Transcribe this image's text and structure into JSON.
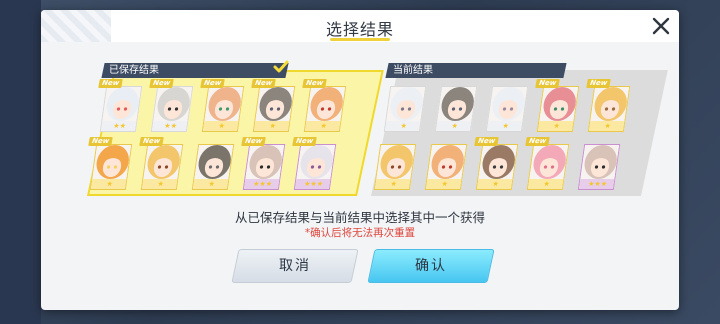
{
  "dialog": {
    "title": "选择结果",
    "close_icon": "close-icon"
  },
  "saved": {
    "label": "已保存结果",
    "selected_icon": "checkmark-icon",
    "cards": [
      {
        "new": "New",
        "stars": "★★",
        "rarity": "gray",
        "hair": "#e9eef5",
        "accent": "#e25a5a"
      },
      {
        "new": "New",
        "stars": "★★",
        "rarity": "gray",
        "hair": "#d8d6d3",
        "accent": "#333333"
      },
      {
        "new": "New",
        "stars": "★",
        "rarity": "gold",
        "hair": "#f0b48c",
        "accent": "#3c9a6a"
      },
      {
        "new": "New",
        "stars": "★",
        "rarity": "gold",
        "hair": "#8b857e",
        "accent": "#5a6070"
      },
      {
        "new": "New",
        "stars": "★",
        "rarity": "gold",
        "hair": "#f2b178",
        "accent": "#c0392b"
      },
      {
        "new": "New",
        "stars": "★",
        "rarity": "gold",
        "hair": "#f4a64a",
        "accent": "#f7d25a"
      },
      {
        "new": "New",
        "stars": "★",
        "rarity": "gold",
        "hair": "#f3c66b",
        "accent": "#8a4a2a"
      },
      {
        "new": "",
        "stars": "★",
        "rarity": "gold",
        "hair": "#7b746a",
        "accent": "#6b6b6b"
      },
      {
        "new": "New",
        "stars": "★★★",
        "rarity": "purple",
        "hair": "#d9c3b8",
        "accent": "#2b2b2b"
      },
      {
        "new": "New",
        "stars": "★★★",
        "rarity": "purple",
        "hair": "#e7e3ea",
        "accent": "#8a5a9a"
      }
    ]
  },
  "current": {
    "label": "当前结果",
    "cards": [
      {
        "new": "",
        "stars": "★",
        "rarity": "gray",
        "hair": "#eceff3",
        "accent": "#7a7a8a"
      },
      {
        "new": "",
        "stars": "★",
        "rarity": "gray",
        "hair": "#8b857e",
        "accent": "#5a6070"
      },
      {
        "new": "",
        "stars": "★",
        "rarity": "gray",
        "hair": "#eceff3",
        "accent": "#9a8aa0"
      },
      {
        "new": "New",
        "stars": "★",
        "rarity": "gold",
        "hair": "#e88f96",
        "accent": "#3a8f6a"
      },
      {
        "new": "New",
        "stars": "★",
        "rarity": "gold",
        "hair": "#f3c66b",
        "accent": "#9a6a3a"
      },
      {
        "new": "",
        "stars": "★",
        "rarity": "gold",
        "hair": "#f3c66b",
        "accent": "#8a4a2a"
      },
      {
        "new": "",
        "stars": "★",
        "rarity": "gold",
        "hair": "#f2b178",
        "accent": "#c0392b"
      },
      {
        "new": "New",
        "stars": "★",
        "rarity": "gold",
        "hair": "#9a7a64",
        "accent": "#3a3a3a"
      },
      {
        "new": "New",
        "stars": "★",
        "rarity": "gold",
        "hair": "#f3a9b8",
        "accent": "#e2708a"
      },
      {
        "new": "",
        "stars": "★★★",
        "rarity": "purple",
        "hair": "#d9c3b8",
        "accent": "#2b2b2b"
      }
    ]
  },
  "hint": "从已保存结果与当前结果中选择其中一个获得",
  "warning": "*确认后将无法再次重置",
  "buttons": {
    "cancel": "取消",
    "confirm": "确认"
  },
  "colors": {
    "saved_panel": "#fbf5a8",
    "saved_border": "#f0d92c",
    "current_panel": "#dcdcdc",
    "confirm_button": "#47c6f0",
    "warning_text": "#e0463c"
  }
}
